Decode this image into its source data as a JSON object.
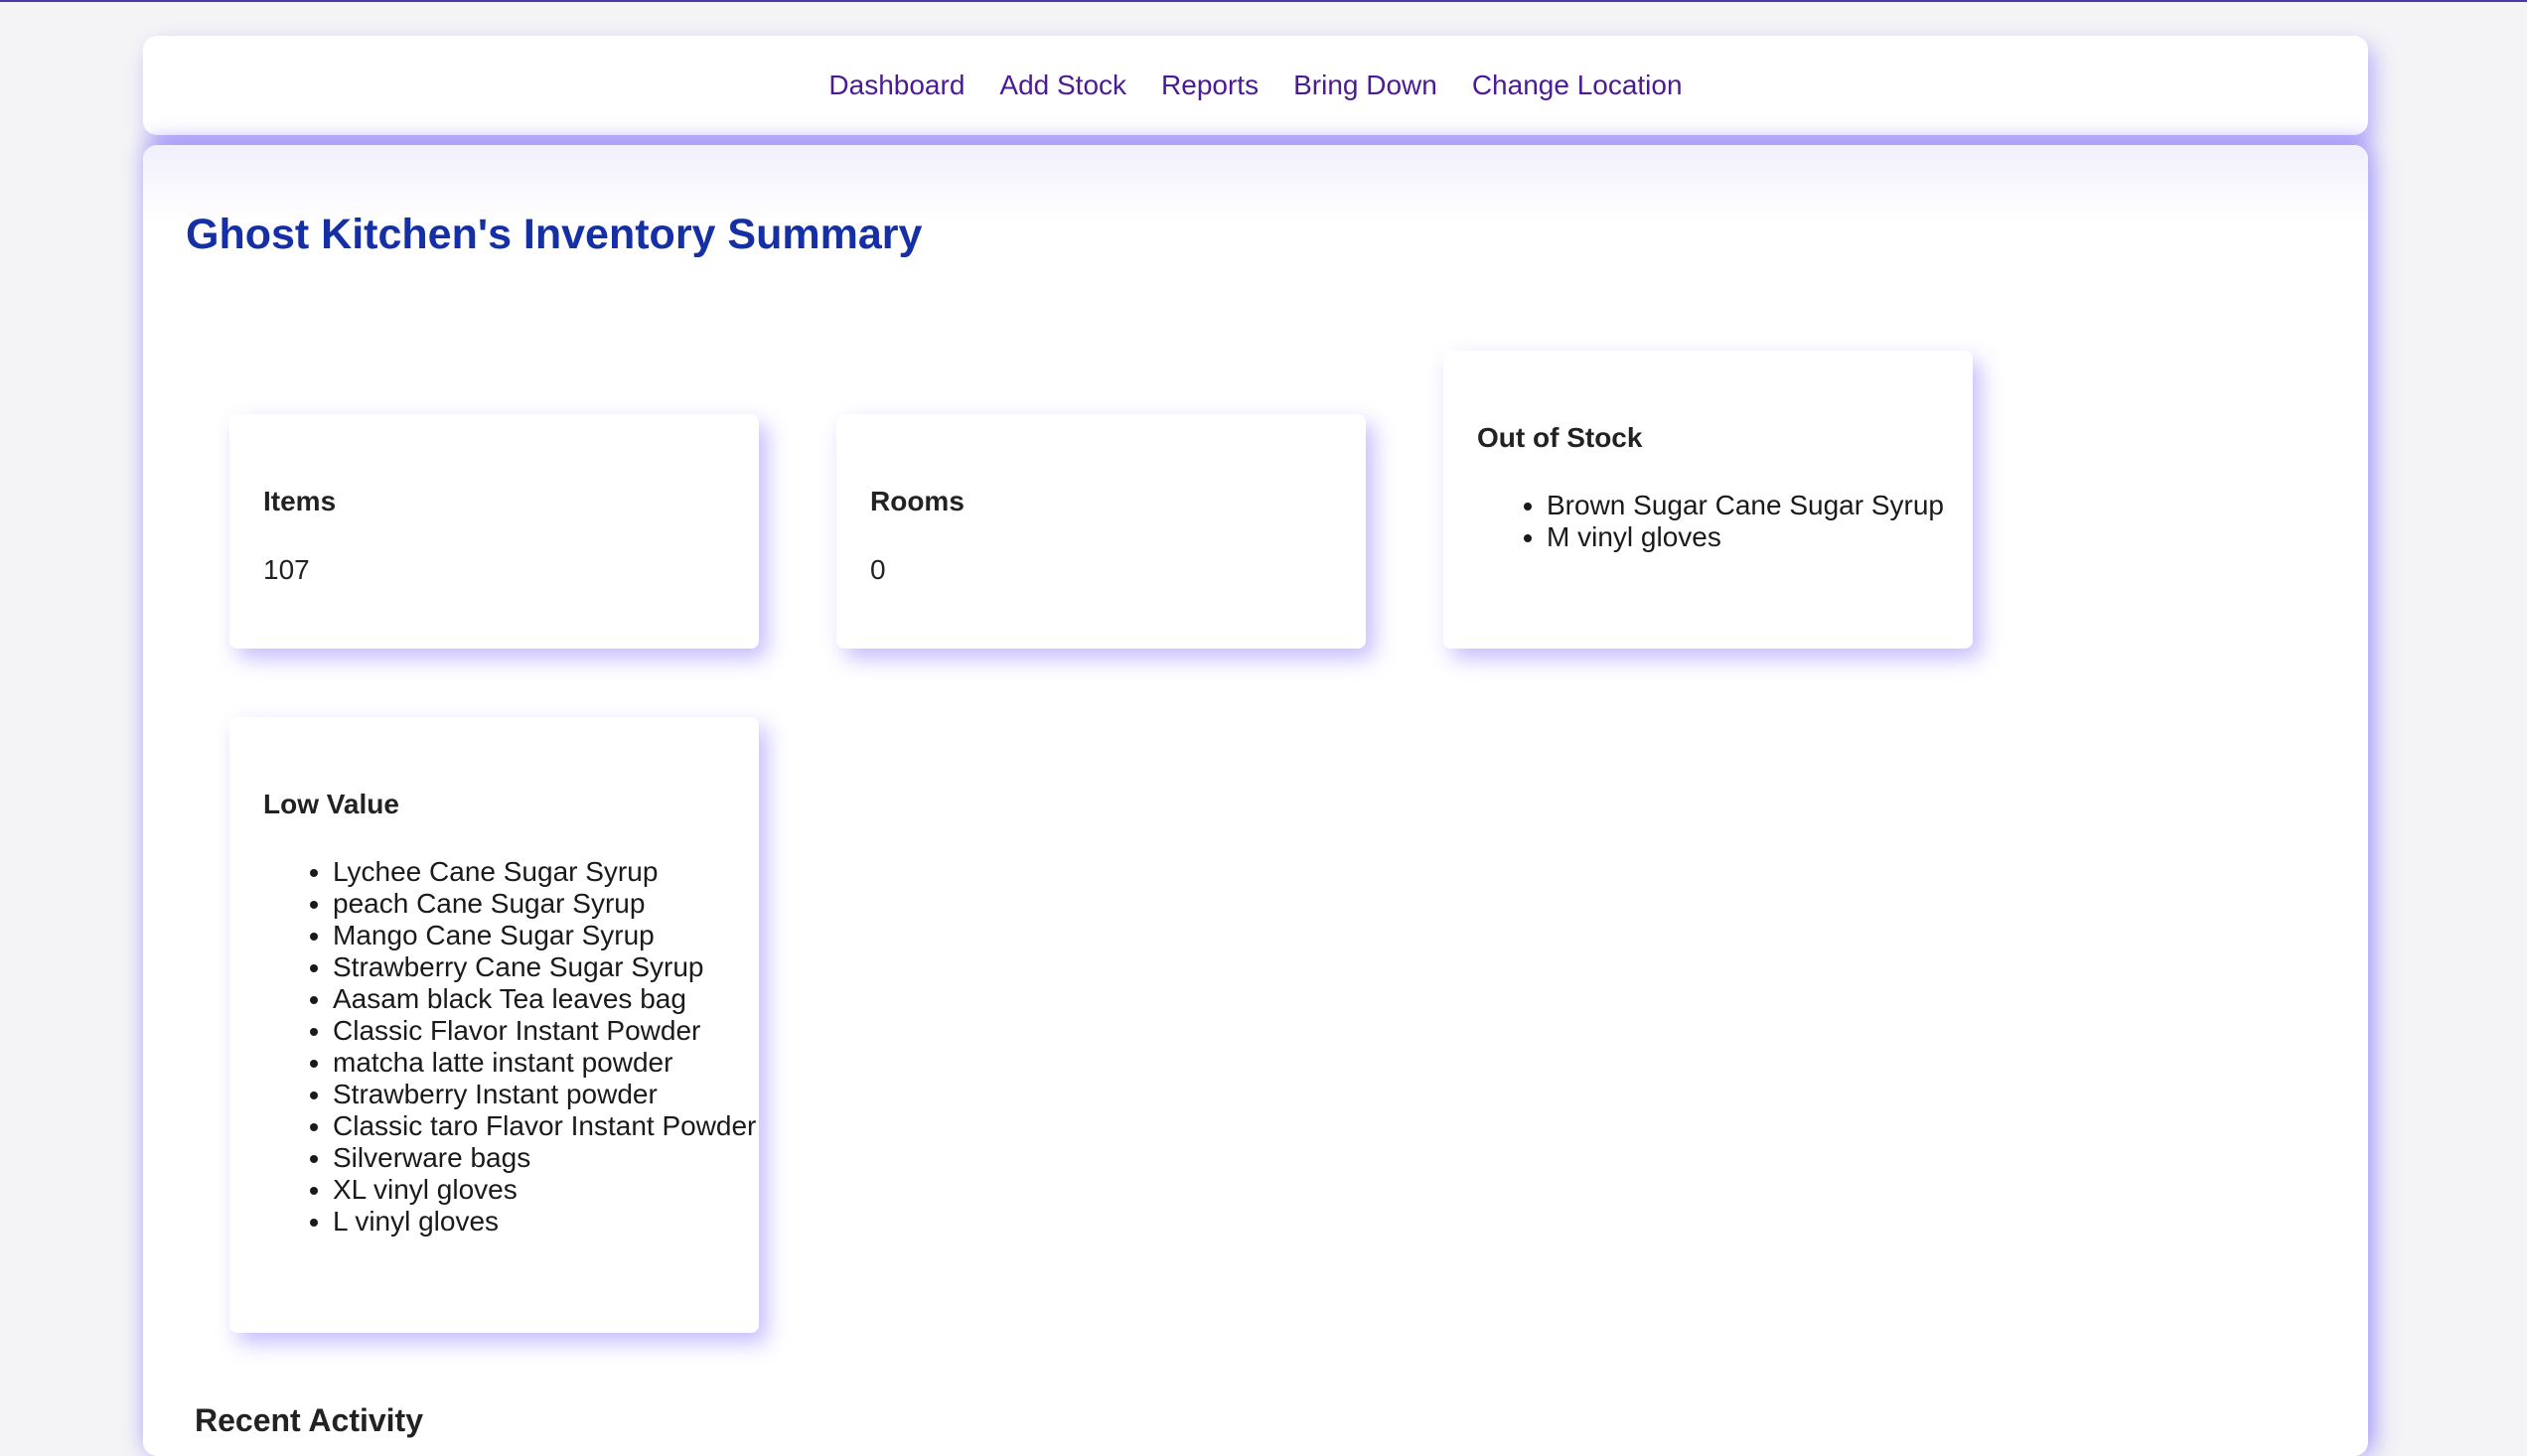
{
  "nav": {
    "links": [
      "Dashboard",
      "Add Stock",
      "Reports",
      "Bring Down",
      "Change Location"
    ]
  },
  "page": {
    "title": "Ghost Kitchen's Inventory Summary"
  },
  "cards": {
    "items": {
      "title": "Items",
      "value": "107"
    },
    "rooms": {
      "title": "Rooms",
      "value": "0"
    },
    "out_of_stock": {
      "title": "Out of Stock",
      "list": [
        "Brown Sugar Cane Sugar Syrup",
        "M vinyl gloves"
      ]
    },
    "low_value": {
      "title": "Low Value",
      "list": [
        "Lychee Cane Sugar Syrup",
        "peach Cane Sugar Syrup",
        "Mango Cane Sugar Syrup",
        "Strawberry Cane Sugar Syrup",
        "Aasam black Tea leaves bag",
        "Classic Flavor Instant Powder",
        "matcha latte instant powder",
        "Strawberry Instant powder",
        "Classic taro Flavor Instant Powder",
        "Silverware bags",
        "XL vinyl gloves",
        "L vinyl gloves"
      ]
    }
  },
  "recent_activity": {
    "title": "Recent Activity"
  },
  "colors": {
    "nav_link": "#4b1a96",
    "title": "#1530a4",
    "shadow": "#6e5aff"
  }
}
